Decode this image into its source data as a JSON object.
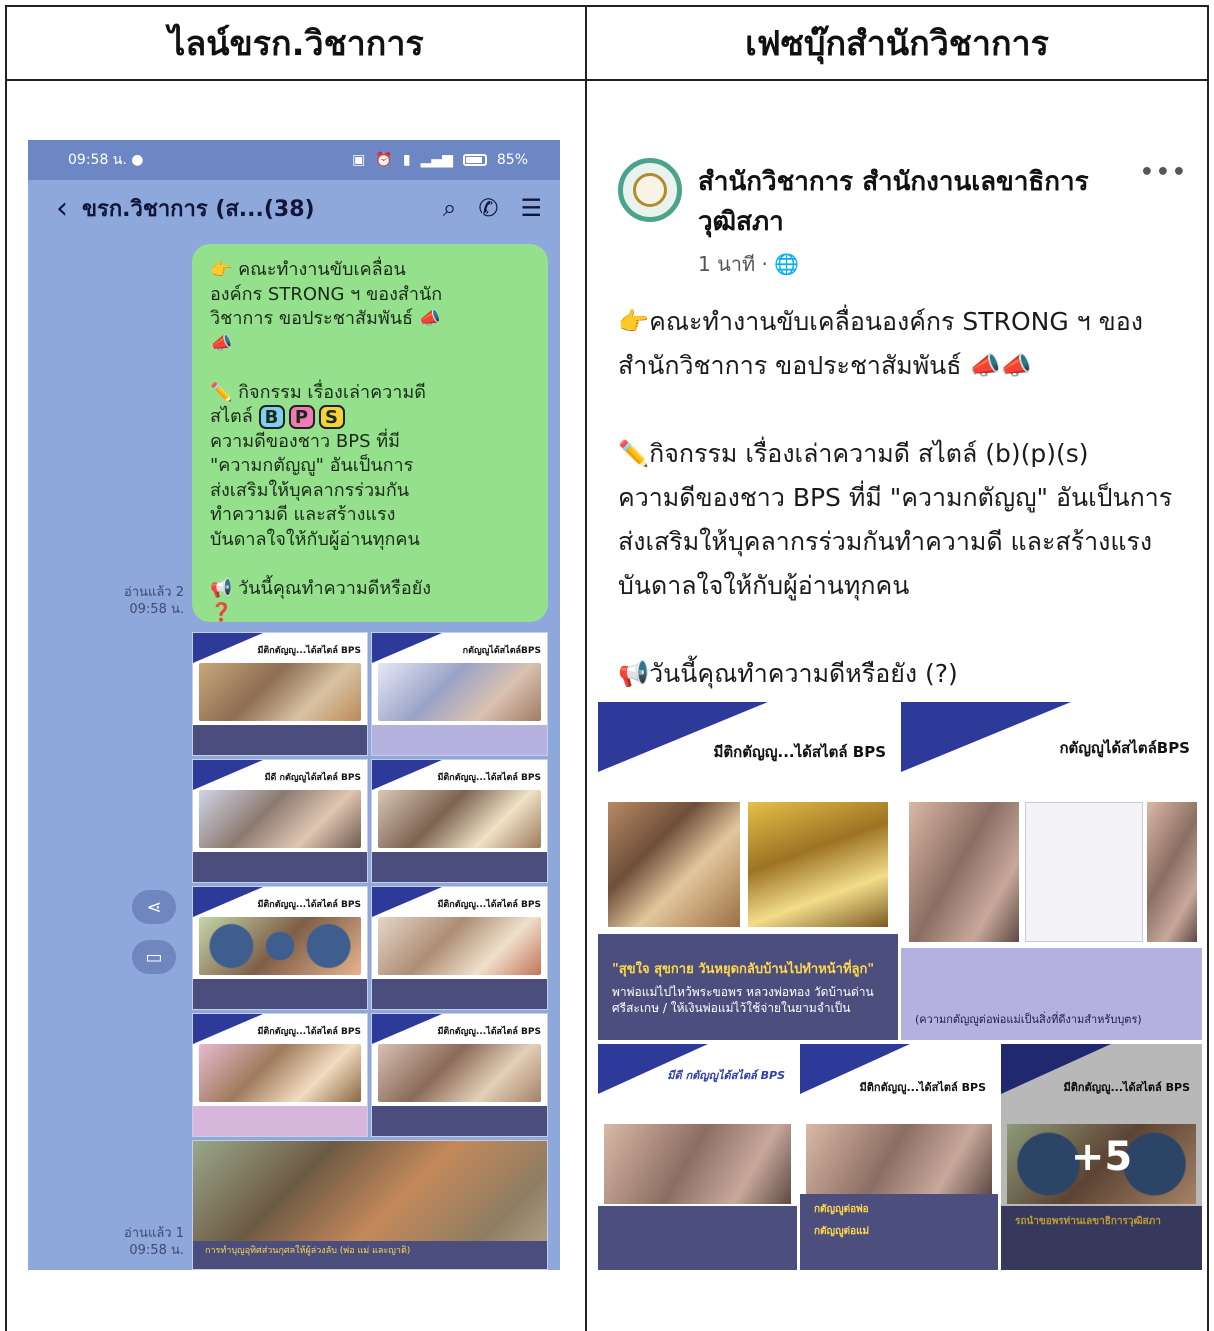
{
  "table": {
    "left_header": "ไลน์ขรก.วิชาการ",
    "right_header": "เฟซบุ๊กสำนักวิชาการ"
  },
  "line": {
    "status_time": "09:58 น.",
    "battery": "85%",
    "chat_title": "ขรก.วิชาการ (ส...(38)",
    "message_lines": [
      "👉 คณะทำงานขับเคลื่อน",
      "องค์กร STRONG ฯ ของสำนัก",
      "วิชาการ ขอประชาสัมพันธ์ 📣",
      "📣",
      "",
      "✏️ กิจกรรม เรื่องเล่าความดี",
      "สไตล์",
      "ความดีของชาว BPS ที่มี",
      "\"ความกตัญญู\" อันเป็นการ",
      "ส่งเสริมให้บุคลากรร่วมกัน",
      "ทำความดี และสร้างแรง",
      "บันดาลใจให้กับผู้อ่านทุกคน",
      "",
      "📢 วันนี้คุณทำความดีหรือยัง",
      "❓"
    ],
    "bps_letters": [
      "B",
      "P",
      "S"
    ],
    "read_1": "อ่านแล้ว 2",
    "time_1": "09:58 น.",
    "read_2": "อ่านแล้ว 1",
    "time_2": "09:58 น.",
    "thumb_titles": [
      "มีติกตัญญู...ได้สไตล์ BPS",
      "กตัญญูได้สไตล์BPS",
      "มีดี กตัญญูได้สไตล์ BPS",
      "มีติกตัญญู...ได้สไตล์ BPS",
      "มีติกตัญญู...ได้สไตล์ BPS",
      "มีติกตัญญู...ได้สไตล์ BPS",
      "มีติกตัญญู...ได้สไตล์ BPS",
      "มีติกตัญญู...ได้สไตล์ BPS"
    ],
    "last_caption": "การทำบุญอุทิศส่วนกุศลให้ผู้ล่วงลับ (พ่อ แม่ และญาติ)"
  },
  "facebook": {
    "page_name": "สำนักวิชาการ สำนักงานเลขาธิการวุฒิสภา",
    "time": "1 นาที · 🌐",
    "more": "•••",
    "post_lines": [
      "👉คณะทำงานขับเคลื่อนองค์กร STRONG ฯ ของ",
      "สำนักวิชาการ ขอประชาสัมพันธ์ 📣📣",
      "",
      "✏️กิจกรรม เรื่องเล่าความดี สไตล์ (b)(p)(s)",
      "ความดีของชาว BPS ที่มี \"ความกตัญญู\" อันเป็นการ",
      "ส่งเสริมให้บุคลากรร่วมกันทำความดี และสร้างแรง",
      "บันดาลใจให้กับผู้อ่านทุกคน",
      "",
      "📢วันนี้คุณทำความดีหรือยัง (?)"
    ],
    "photos": [
      {
        "title": "มีติกตัญญู...ได้สไตล์ BPS",
        "caption_highlight": "\"สุขใจ สุขกาย วันหยุดกลับบ้านไปทำหน้าที่ลูก\"",
        "caption": "พาพ่อแม่ไปไหว้พระขอพร หลวงพ่อทอง วัดบ้านด่าน ศรีสะเกษ / ให้เงินพ่อแม่ไว้ใช้จ่ายในยามจำเป็น"
      },
      {
        "title": "กตัญญูได้สไตล์BPS",
        "caption_highlight": "",
        "caption": "(ความกตัญญูต่อพ่อแม่เป็นสิ่งที่ดีงามสำหรับบุตร)"
      },
      {
        "title": "มีดี กตัญญูได้สไตล์ BPS",
        "caption_highlight": "",
        "caption": ""
      },
      {
        "title": "มีติกตัญญู...ได้สไตล์ BPS",
        "caption_highlight": "กตัญญูต่อพ่อ",
        "caption": "กตัญญูต่อแม่"
      },
      {
        "title": "มีติกตัญญู...ได้สไตล์ BPS",
        "caption_highlight": "รถนำขอพรท่านเลขาธิการวุฒิสภา",
        "caption": "",
        "more_count": "+5"
      }
    ]
  }
}
